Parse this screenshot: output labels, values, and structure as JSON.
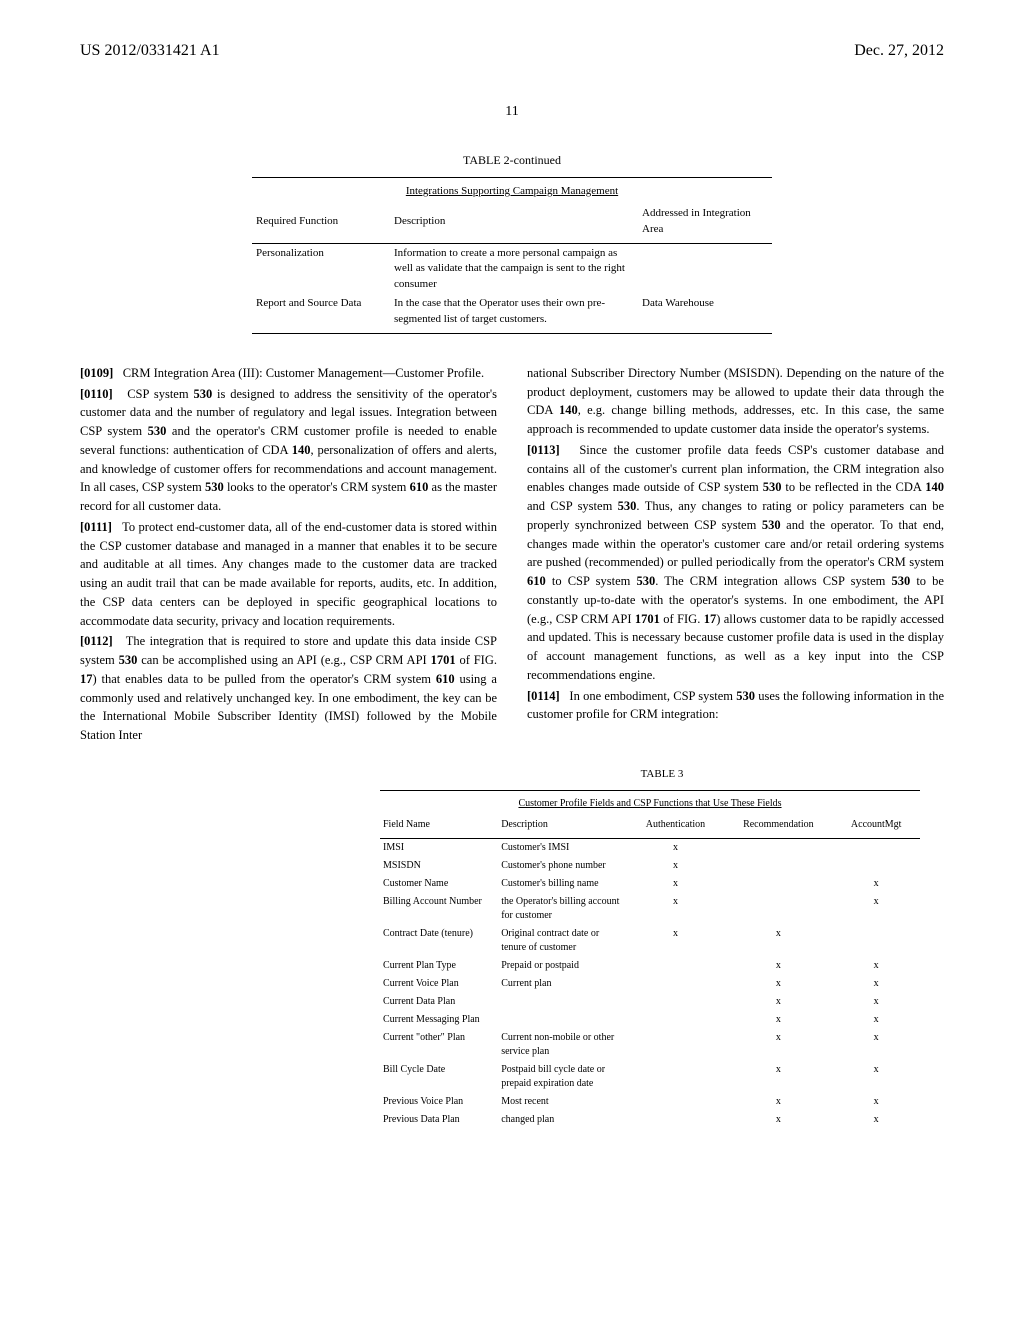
{
  "header": {
    "pub_number": "US 2012/0331421 A1",
    "pub_date": "Dec. 27, 2012",
    "page_number": "11"
  },
  "table2": {
    "title": "TABLE 2-continued",
    "subtitle": "Integrations Supporting Campaign Management",
    "headers": {
      "c1": "Required Function",
      "c2": "Description",
      "c3": "Addressed in Integration Area"
    },
    "rows": [
      {
        "c1": "Personalization",
        "c2": "Information to create a more personal campaign as well as validate that the campaign is sent to the right consumer",
        "c3": ""
      },
      {
        "c1": "Report and Source Data",
        "c2": "In the case that the Operator uses their own pre-segmented list of target customers.",
        "c3": "Data Warehouse"
      }
    ]
  },
  "paragraphs": {
    "p109": "CRM Integration Area (III): Customer Management—Customer Profile.",
    "p110_a": "CSP system ",
    "p110_b": " is designed to address the sensitivity of the operator's customer data and the number of regulatory and legal issues. Integration between CSP system ",
    "p110_c": " and the operator's CRM customer profile is needed to enable several functions: authentication of CDA ",
    "p110_d": ", personalization of offers and alerts, and knowledge of customer offers for recommendations and account management. In all cases, CSP system ",
    "p110_e": " looks to the operator's CRM system ",
    "p110_f": " as the master record for all customer data.",
    "p111": "To protect end-customer data, all of the end-customer data is stored within the CSP customer database and managed in a manner that enables it to be secure and auditable at all times. Any changes made to the customer data are tracked using an audit trail that can be made available for reports, audits, etc. In addition, the CSP data centers can be deployed in specific geographical locations to accommodate data security, privacy and location requirements.",
    "p112_a": "The integration that is required to store and update this data inside CSP system ",
    "p112_b": " can be accomplished using an API (e.g., CSP CRM API ",
    "p112_c": " of FIG. ",
    "p112_d": ") that enables data to be pulled from the operator's CRM system ",
    "p112_e": " using a commonly used and relatively unchanged key. In one embodiment, the key can be the International Mobile Subscriber Identity (IMSI) followed by the Mobile Station Inter",
    "p112_f": "national Subscriber Directory Number (MSISDN). Depending on the nature of the product deployment, customers may be allowed to update their data through the CDA ",
    "p112_g": ", e.g. change billing methods, addresses, etc. In this case, the same approach is recommended to update customer data inside the operator's systems.",
    "p113_a": "Since the customer profile data feeds CSP's customer database and contains all of the customer's current plan information, the CRM integration also enables changes made outside of CSP system ",
    "p113_b": " to be reflected in the CDA ",
    "p113_c": " and CSP system ",
    "p113_d": ". Thus, any changes to rating or policy parameters can be properly synchronized between CSP system ",
    "p113_e": " and the operator. To that end, changes made within the operator's customer care and/or retail ordering systems are pushed (recommended) or pulled periodically from the operator's CRM system ",
    "p113_f": " to CSP system ",
    "p113_g": ". The CRM integration allows CSP system ",
    "p113_h": " to be constantly up-to-date with the operator's systems. In one embodiment, the API (e.g., CSP CRM API ",
    "p113_i": " of FIG. ",
    "p113_j": ") allows customer data to be rapidly accessed and updated. This is necessary because customer profile data is used in the display of account management functions, as well as a key input into the CSP recommendations engine.",
    "p114_a": "In one embodiment, CSP system ",
    "p114_b": " uses the following information in the customer profile for CRM integration:",
    "num_109": "[0109]",
    "num_110": "[0110]",
    "num_111": "[0111]",
    "num_112": "[0112]",
    "num_113": "[0113]",
    "num_114": "[0114]",
    "ref_530": "530",
    "ref_140": "140",
    "ref_610": "610",
    "ref_1701": "1701",
    "ref_17": "17"
  },
  "table3": {
    "title": "TABLE 3",
    "subtitle": "Customer Profile Fields and CSP Functions that Use These Fields",
    "headers": {
      "c1": "Field Name",
      "c2": "Description",
      "c3": "Authentication",
      "c4": "Recommendation",
      "c5": "AccountMgt"
    },
    "rows": [
      {
        "c1": "IMSI",
        "c2": "Customer's IMSI",
        "c3": "x",
        "c4": "",
        "c5": ""
      },
      {
        "c1": "MSISDN",
        "c2": "Customer's phone number",
        "c3": "x",
        "c4": "",
        "c5": ""
      },
      {
        "c1": "Customer Name",
        "c2": "Customer's billing name",
        "c3": "x",
        "c4": "",
        "c5": "x"
      },
      {
        "c1": "Billing Account Number",
        "c2": "the Operator's billing account for customer",
        "c3": "x",
        "c4": "",
        "c5": "x"
      },
      {
        "c1": "Contract Date (tenure)",
        "c2": "Original contract date or tenure of customer",
        "c3": "x",
        "c4": "x",
        "c5": ""
      },
      {
        "c1": "Current Plan Type",
        "c2": "Prepaid or postpaid",
        "c3": "",
        "c4": "x",
        "c5": "x"
      },
      {
        "c1": "Current Voice Plan",
        "c2": "Current plan",
        "c3": "",
        "c4": "x",
        "c5": "x"
      },
      {
        "c1": "Current Data Plan",
        "c2": "",
        "c3": "",
        "c4": "x",
        "c5": "x"
      },
      {
        "c1": "Current Messaging Plan",
        "c2": "",
        "c3": "",
        "c4": "x",
        "c5": "x"
      },
      {
        "c1": "Current \"other\" Plan",
        "c2": "Current non-mobile or other service plan",
        "c3": "",
        "c4": "x",
        "c5": "x"
      },
      {
        "c1": "Bill Cycle Date",
        "c2": "Postpaid bill cycle date or prepaid expiration date",
        "c3": "",
        "c4": "x",
        "c5": "x"
      },
      {
        "c1": "Previous Voice Plan",
        "c2": "Most recent",
        "c3": "",
        "c4": "x",
        "c5": "x"
      },
      {
        "c1": "Previous Data Plan",
        "c2": "changed plan",
        "c3": "",
        "c4": "x",
        "c5": "x"
      }
    ]
  }
}
